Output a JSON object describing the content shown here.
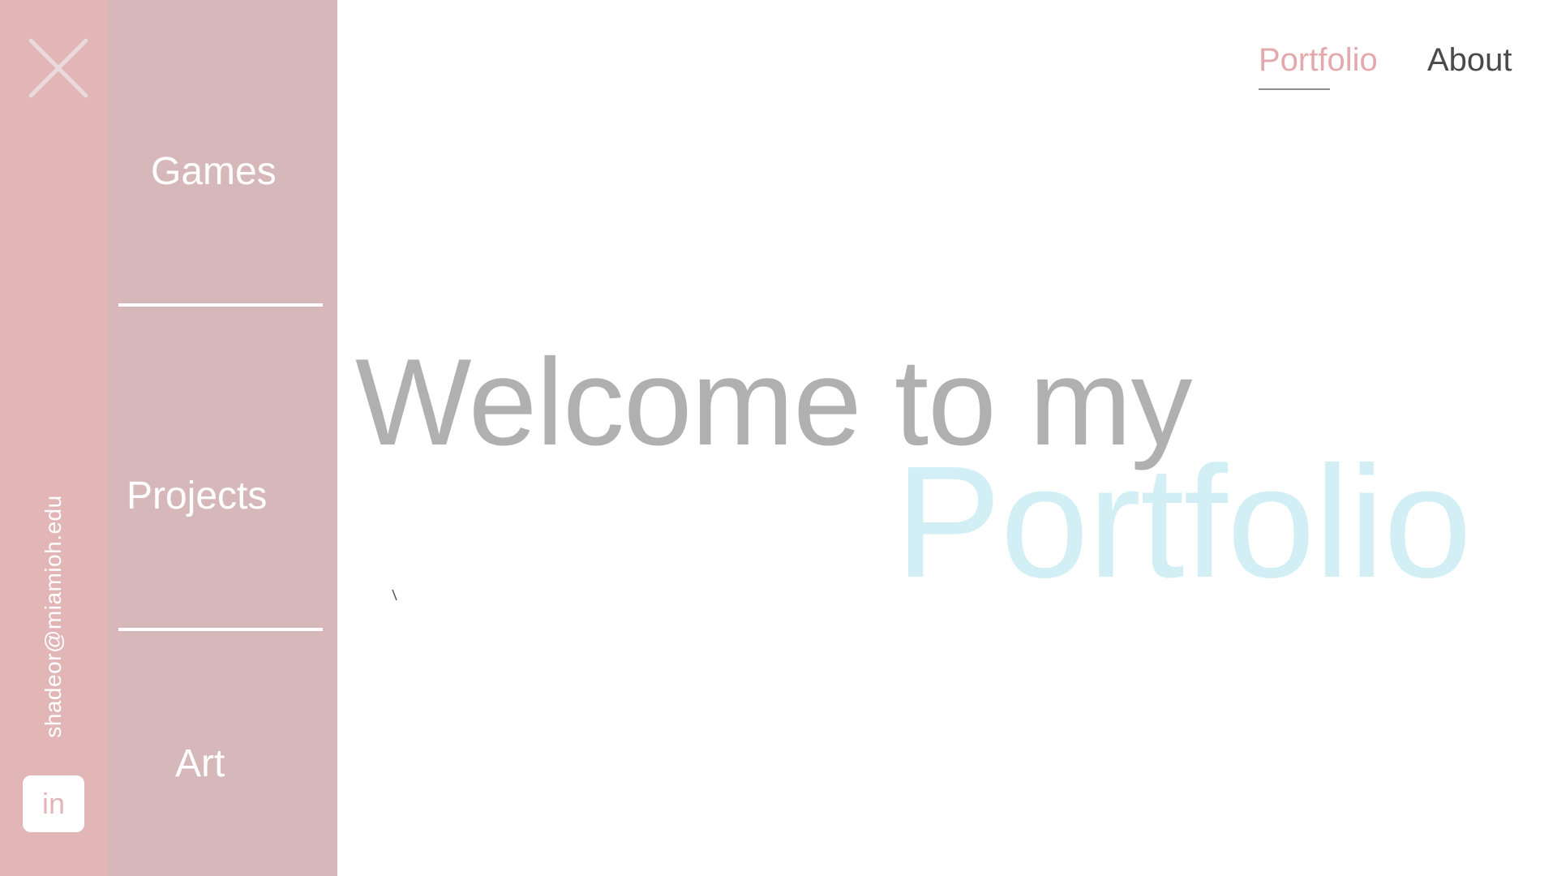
{
  "rail": {
    "email": "shadeor@miamioh.edu",
    "linkedin_label": "in",
    "close_icon": "close-icon"
  },
  "menu": {
    "items": [
      {
        "label": "Games"
      },
      {
        "label": "Projects"
      },
      {
        "label": "Art"
      }
    ]
  },
  "nav": {
    "portfolio_label": "Portfolio",
    "about_label": "About"
  },
  "hero": {
    "line1": "Welcome to my",
    "line2": "Portfolio"
  },
  "colors": {
    "rail": "#e2b5b7",
    "menu": "#d6b8ba",
    "accent_pink": "#e3a9ad",
    "welcome_gray": "#b0b0b0",
    "portfolio_cyan": "#d1eff4"
  }
}
